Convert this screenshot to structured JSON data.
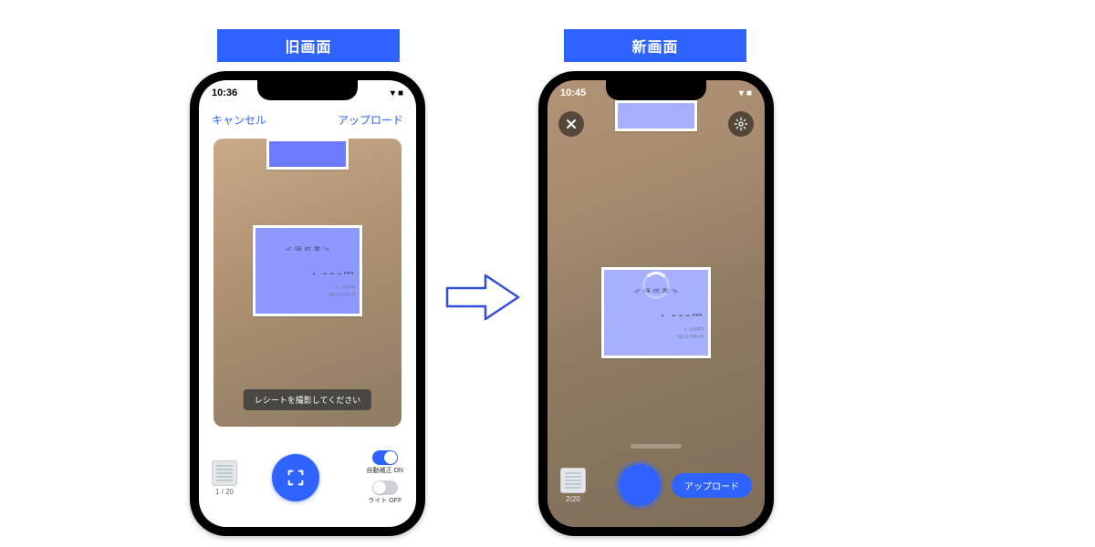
{
  "labels": {
    "old": "旧画面",
    "new": "新画面"
  },
  "old_phone": {
    "status": {
      "time": "10:36",
      "signal": "●●●",
      "wifi": "▾",
      "battery": "■"
    },
    "header": {
      "cancel": "キャンセル",
      "upload": "アップロード"
    },
    "instruction": "レシートを撮影してください",
    "counter": "1 / 20",
    "toggles": {
      "auto_label": "自動補正 ON",
      "light_label": "ライト OFF"
    },
    "receipt": {
      "title": "≪ 領 収 書 ≫",
      "amount": "1,200円",
      "sub1": "1,200円",
      "sub2": "No.070678"
    }
  },
  "new_phone": {
    "status": {
      "time": "10:45",
      "signal": "●●●",
      "wifi": "▾",
      "battery": "■"
    },
    "counter": "2/20",
    "upload": "アップロード",
    "receipt": {
      "title": "≪ 領 収 書 ≫",
      "amount": "1,200円",
      "sub1": "1,200円",
      "sub2": "No.070678"
    }
  }
}
